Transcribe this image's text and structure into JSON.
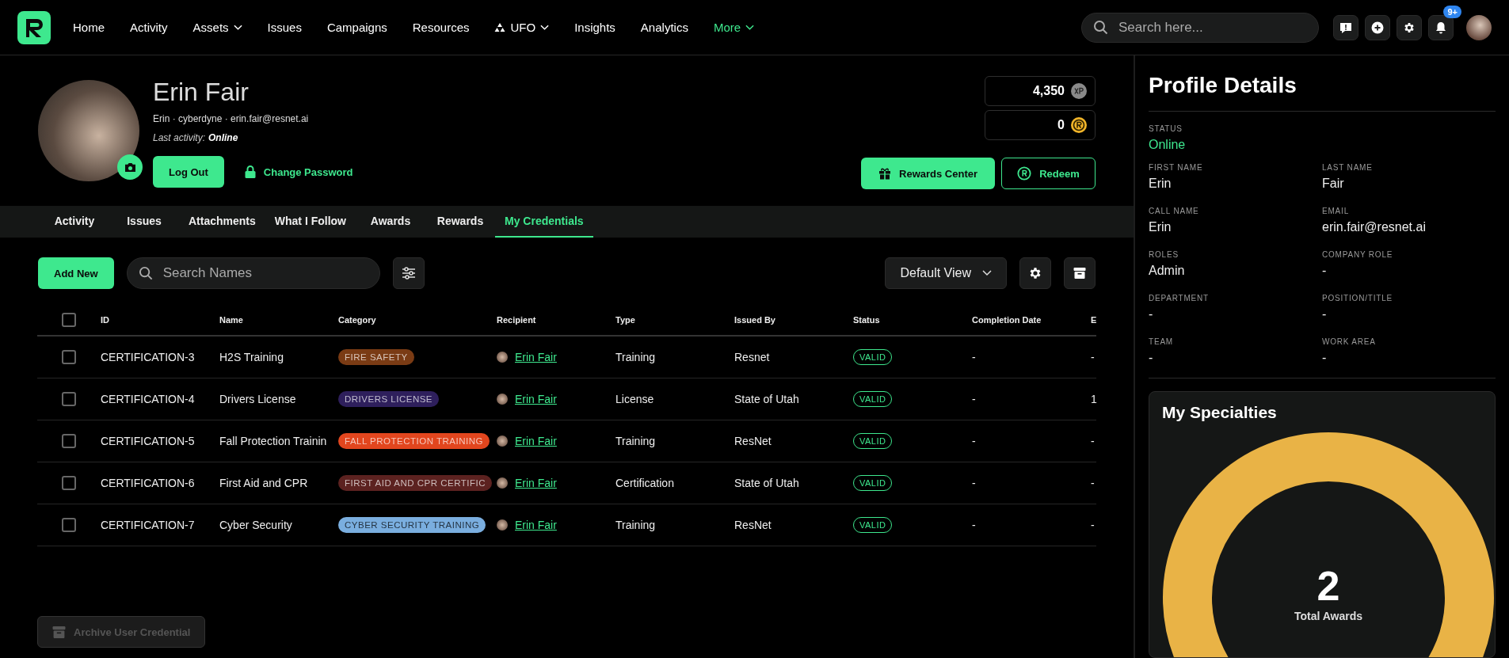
{
  "nav": {
    "items": [
      {
        "label": "Home",
        "kind": "plain",
        "selected": false
      },
      {
        "label": "Activity",
        "kind": "plain",
        "selected": false
      },
      {
        "label": "Assets",
        "kind": "dropdown",
        "selected": false
      },
      {
        "label": "Issues",
        "kind": "plain",
        "selected": false
      },
      {
        "label": "Campaigns",
        "kind": "plain",
        "selected": false
      },
      {
        "label": "Resources",
        "kind": "plain",
        "selected": false
      },
      {
        "label": "UFO",
        "kind": "icon-dropdown",
        "selected": false
      },
      {
        "label": "Insights",
        "kind": "plain",
        "selected": false
      },
      {
        "label": "Analytics",
        "kind": "plain",
        "selected": false
      },
      {
        "label": "More",
        "kind": "dropdown",
        "selected": true
      }
    ],
    "search": {
      "placeholder": "Search here..."
    },
    "notification_badge": "9+"
  },
  "profile": {
    "name": "Erin Fair",
    "subtitle": "Erin · cyberdyne · erin.fair@resnet.ai",
    "last_activity_label": "Last activity:",
    "last_activity": "Online",
    "logout": "Log Out",
    "change_password": "Change Password",
    "xp": "4,350",
    "coins": "0",
    "rewards_center": "Rewards Center",
    "redeem": "Redeem"
  },
  "tabs": [
    {
      "label": "Activity",
      "selected": false
    },
    {
      "label": "Issues",
      "selected": false
    },
    {
      "label": "Attachments",
      "selected": false
    },
    {
      "label": "What I Follow",
      "selected": false
    },
    {
      "label": "Awards",
      "selected": false
    },
    {
      "label": "Rewards",
      "selected": false
    },
    {
      "label": "My Credentials",
      "selected": true
    }
  ],
  "toolbar": {
    "add_new": "Add New",
    "search": {
      "placeholder": "Search Names"
    },
    "view": "Default View"
  },
  "table": {
    "select_all_checked": false,
    "columns": [
      "ID",
      "Name",
      "Category",
      "Recipient",
      "Type",
      "Issued By",
      "Status",
      "Completion Date",
      "E"
    ],
    "rows": [
      {
        "checked": false,
        "id": "CERTIFICATION-3",
        "name": "H2S Training",
        "category": {
          "label": "FIRE SAFETY",
          "color": "#7a3b14"
        },
        "recipient": "Erin Fair",
        "type": "Training",
        "issued_by": "Resnet",
        "status": "VALID",
        "completion_date": "-",
        "column_10": "-"
      },
      {
        "checked": false,
        "id": "CERTIFICATION-4",
        "name": "Drivers License",
        "category": {
          "label": "DRIVERS LICENSE",
          "color": "#2e1f5c"
        },
        "recipient": "Erin Fair",
        "type": "License",
        "issued_by": "State of Utah",
        "status": "VALID",
        "completion_date": "-",
        "column_10": "1"
      },
      {
        "checked": false,
        "id": "CERTIFICATION-5",
        "name": "Fall Protection Trainin",
        "category": {
          "label": "FALL PROTECTION TRAINING",
          "color": "#e2461e"
        },
        "recipient": "Erin Fair",
        "type": "Training",
        "issued_by": "ResNet",
        "status": "VALID",
        "completion_date": "-",
        "column_10": "-"
      },
      {
        "checked": false,
        "id": "CERTIFICATION-6",
        "name": "First Aid and CPR",
        "category": {
          "label": "FIRST AID AND CPR CERTIFIC",
          "color": "#5c2220"
        },
        "recipient": "Erin Fair",
        "type": "Certification",
        "issued_by": "State of Utah",
        "status": "VALID",
        "completion_date": "-",
        "column_10": "-"
      },
      {
        "checked": false,
        "id": "CERTIFICATION-7",
        "name": "Cyber Security",
        "category": {
          "label": "CYBER SECURITY TRAINING",
          "color": "#7aaedf"
        },
        "recipient": "Erin Fair",
        "type": "Training",
        "issued_by": "ResNet",
        "status": "VALID",
        "completion_date": "-",
        "column_10": "-"
      }
    ]
  },
  "archive_button": {
    "label": "Archive User Credential",
    "disabled": true
  },
  "details": {
    "title": "Profile Details",
    "status": {
      "label": "STATUS",
      "value": "Online"
    },
    "fields": [
      {
        "label": "FIRST NAME",
        "value": "Erin"
      },
      {
        "label": "LAST NAME",
        "value": "Fair"
      },
      {
        "label": "CALL NAME",
        "value": "Erin"
      },
      {
        "label": "EMAIL",
        "value": "erin.fair@resnet.ai"
      },
      {
        "label": "ROLES",
        "value": "Admin"
      },
      {
        "label": "COMPANY ROLE",
        "value": "-"
      },
      {
        "label": "DEPARTMENT",
        "value": "-"
      },
      {
        "label": "POSITION/TITLE",
        "value": "-"
      },
      {
        "label": "TEAM",
        "value": "-"
      },
      {
        "label": "WORK AREA",
        "value": "-"
      }
    ]
  },
  "specialties": {
    "title": "My Specialties",
    "total": "2",
    "total_label": "Total Awards"
  }
}
